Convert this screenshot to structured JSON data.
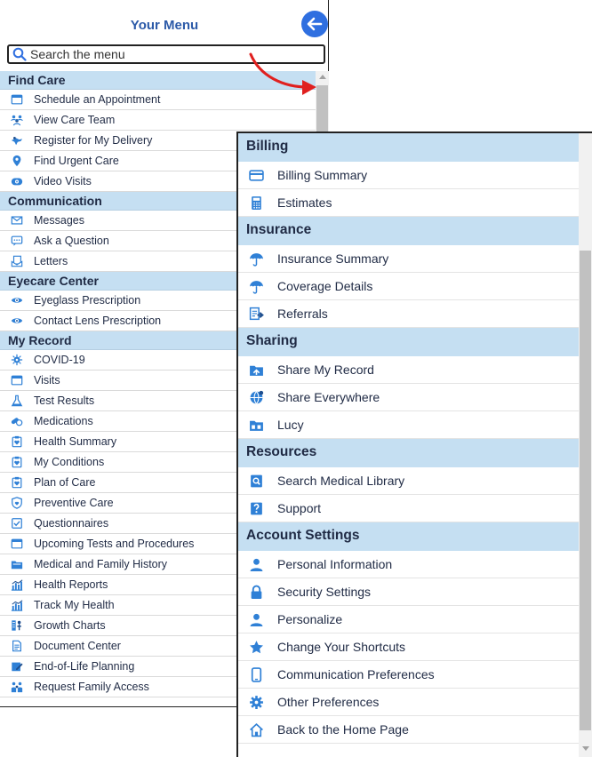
{
  "header": {
    "title": "Your Menu",
    "back_icon": "arrow-left-icon"
  },
  "search": {
    "placeholder": "Search the menu",
    "value": ""
  },
  "colors": {
    "accent": "#2f6fe0",
    "section_bg": "#c5dff2",
    "icon_blue": "#2f80d6",
    "arrow_red": "#e0201f"
  },
  "left_sections": [
    {
      "label": "Find Care",
      "items": [
        {
          "label": "Schedule an Appointment",
          "icon": "calendar-icon"
        },
        {
          "label": "View Care Team",
          "icon": "team-icon"
        },
        {
          "label": "Register for My Delivery",
          "icon": "stork-icon"
        },
        {
          "label": "Find Urgent Care",
          "icon": "map-pin-icon"
        },
        {
          "label": "Video Visits",
          "icon": "video-camera-icon"
        }
      ]
    },
    {
      "label": "Communication",
      "items": [
        {
          "label": "Messages",
          "icon": "envelope-icon"
        },
        {
          "label": "Ask a Question",
          "icon": "chat-bubble-icon"
        },
        {
          "label": "Letters",
          "icon": "letter-icon"
        }
      ]
    },
    {
      "label": "Eyecare Center",
      "items": [
        {
          "label": "Eyeglass Prescription",
          "icon": "eye-icon"
        },
        {
          "label": "Contact Lens Prescription",
          "icon": "eye-icon"
        }
      ]
    },
    {
      "label": "My Record",
      "items": [
        {
          "label": "COVID-19",
          "icon": "virus-icon"
        },
        {
          "label": "Visits",
          "icon": "calendar-icon"
        },
        {
          "label": "Test Results",
          "icon": "flask-icon"
        },
        {
          "label": "Medications",
          "icon": "pills-icon"
        },
        {
          "label": "Health Summary",
          "icon": "clipboard-heart-icon"
        },
        {
          "label": "My Conditions",
          "icon": "clipboard-heart-icon"
        },
        {
          "label": "Plan of Care",
          "icon": "clipboard-heart-icon"
        },
        {
          "label": "Preventive Care",
          "icon": "shield-heart-icon"
        },
        {
          "label": "Questionnaires",
          "icon": "checklist-icon"
        },
        {
          "label": "Upcoming Tests and Procedures",
          "icon": "calendar-icon"
        },
        {
          "label": "Medical and Family History",
          "icon": "folder-icon"
        },
        {
          "label": "Health Reports",
          "icon": "bar-chart-icon"
        },
        {
          "label": "Track My Health",
          "icon": "bar-chart-icon"
        },
        {
          "label": "Growth Charts",
          "icon": "growth-chart-icon"
        },
        {
          "label": "Document Center",
          "icon": "document-icon"
        },
        {
          "label": "End-of-Life Planning",
          "icon": "pen-paper-icon"
        },
        {
          "label": "Request Family Access",
          "icon": "family-icon"
        }
      ]
    }
  ],
  "right_sections": [
    {
      "label": "Billing",
      "items": [
        {
          "label": "Billing Summary",
          "icon": "credit-card-icon"
        },
        {
          "label": "Estimates",
          "icon": "calculator-icon"
        }
      ]
    },
    {
      "label": "Insurance",
      "items": [
        {
          "label": "Insurance Summary",
          "icon": "umbrella-icon"
        },
        {
          "label": "Coverage Details",
          "icon": "umbrella-icon"
        },
        {
          "label": "Referrals",
          "icon": "referral-icon"
        }
      ]
    },
    {
      "label": "Sharing",
      "items": [
        {
          "label": "Share My Record",
          "icon": "share-folder-icon"
        },
        {
          "label": "Share Everywhere",
          "icon": "globe-icon"
        },
        {
          "label": "Lucy",
          "icon": "lucy-folder-icon"
        }
      ]
    },
    {
      "label": "Resources",
      "items": [
        {
          "label": "Search Medical Library",
          "icon": "library-icon"
        },
        {
          "label": "Support",
          "icon": "support-icon"
        }
      ]
    },
    {
      "label": "Account Settings",
      "items": [
        {
          "label": "Personal Information",
          "icon": "person-icon"
        },
        {
          "label": "Security Settings",
          "icon": "lock-icon"
        },
        {
          "label": "Personalize",
          "icon": "person-icon"
        },
        {
          "label": "Change Your Shortcuts",
          "icon": "star-icon"
        },
        {
          "label": "Communication Preferences",
          "icon": "phone-icon"
        },
        {
          "label": "Other Preferences",
          "icon": "gear-icon"
        },
        {
          "label": "Back to the Home Page",
          "icon": "home-icon"
        }
      ]
    }
  ]
}
